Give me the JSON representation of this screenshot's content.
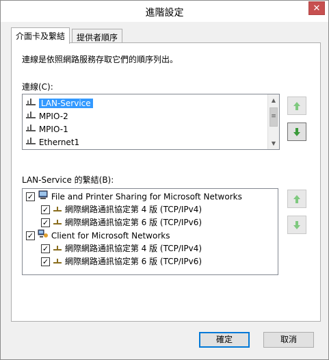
{
  "window": {
    "title": "進階設定",
    "close_glyph": "✕"
  },
  "tabs": [
    {
      "label": "介面卡及繫結",
      "active": true
    },
    {
      "label": "提供者順序",
      "active": false
    }
  ],
  "description": "連線是依照網路服務存取它們的順序列出。",
  "connections": {
    "label": "連線(C):",
    "items": [
      {
        "label": "LAN-Service",
        "selected": true
      },
      {
        "label": "MPIO-2",
        "selected": false
      },
      {
        "label": "MPIO-1",
        "selected": false
      },
      {
        "label": "Ethernet1",
        "selected": false
      }
    ]
  },
  "bindings": {
    "label": "LAN-Service 的繫結(B):",
    "items": [
      {
        "label": "File and Printer Sharing for Microsoft Networks",
        "checked": true,
        "level": 0,
        "icon": "file-printer-sharing-icon"
      },
      {
        "label": "網際網路通訊協定第 4 版 (TCP/IPv4)",
        "checked": true,
        "level": 1,
        "icon": "protocol-icon"
      },
      {
        "label": "網際網路通訊協定第 6 版 (TCP/IPv6)",
        "checked": true,
        "level": 1,
        "icon": "protocol-icon"
      },
      {
        "label": "Client for Microsoft Networks",
        "checked": true,
        "level": 0,
        "icon": "client-network-icon"
      },
      {
        "label": "網際網路通訊協定第 4 版 (TCP/IPv4)",
        "checked": true,
        "level": 1,
        "icon": "protocol-icon"
      },
      {
        "label": "網際網路通訊協定第 6 版 (TCP/IPv6)",
        "checked": true,
        "level": 1,
        "icon": "protocol-icon"
      }
    ]
  },
  "buttons": {
    "ok": "確定",
    "cancel": "取消"
  },
  "colors": {
    "selection": "#3399ff",
    "arrow_up": "#5cb85c",
    "arrow_down": "#3a9a3a",
    "close": "#c75050"
  }
}
